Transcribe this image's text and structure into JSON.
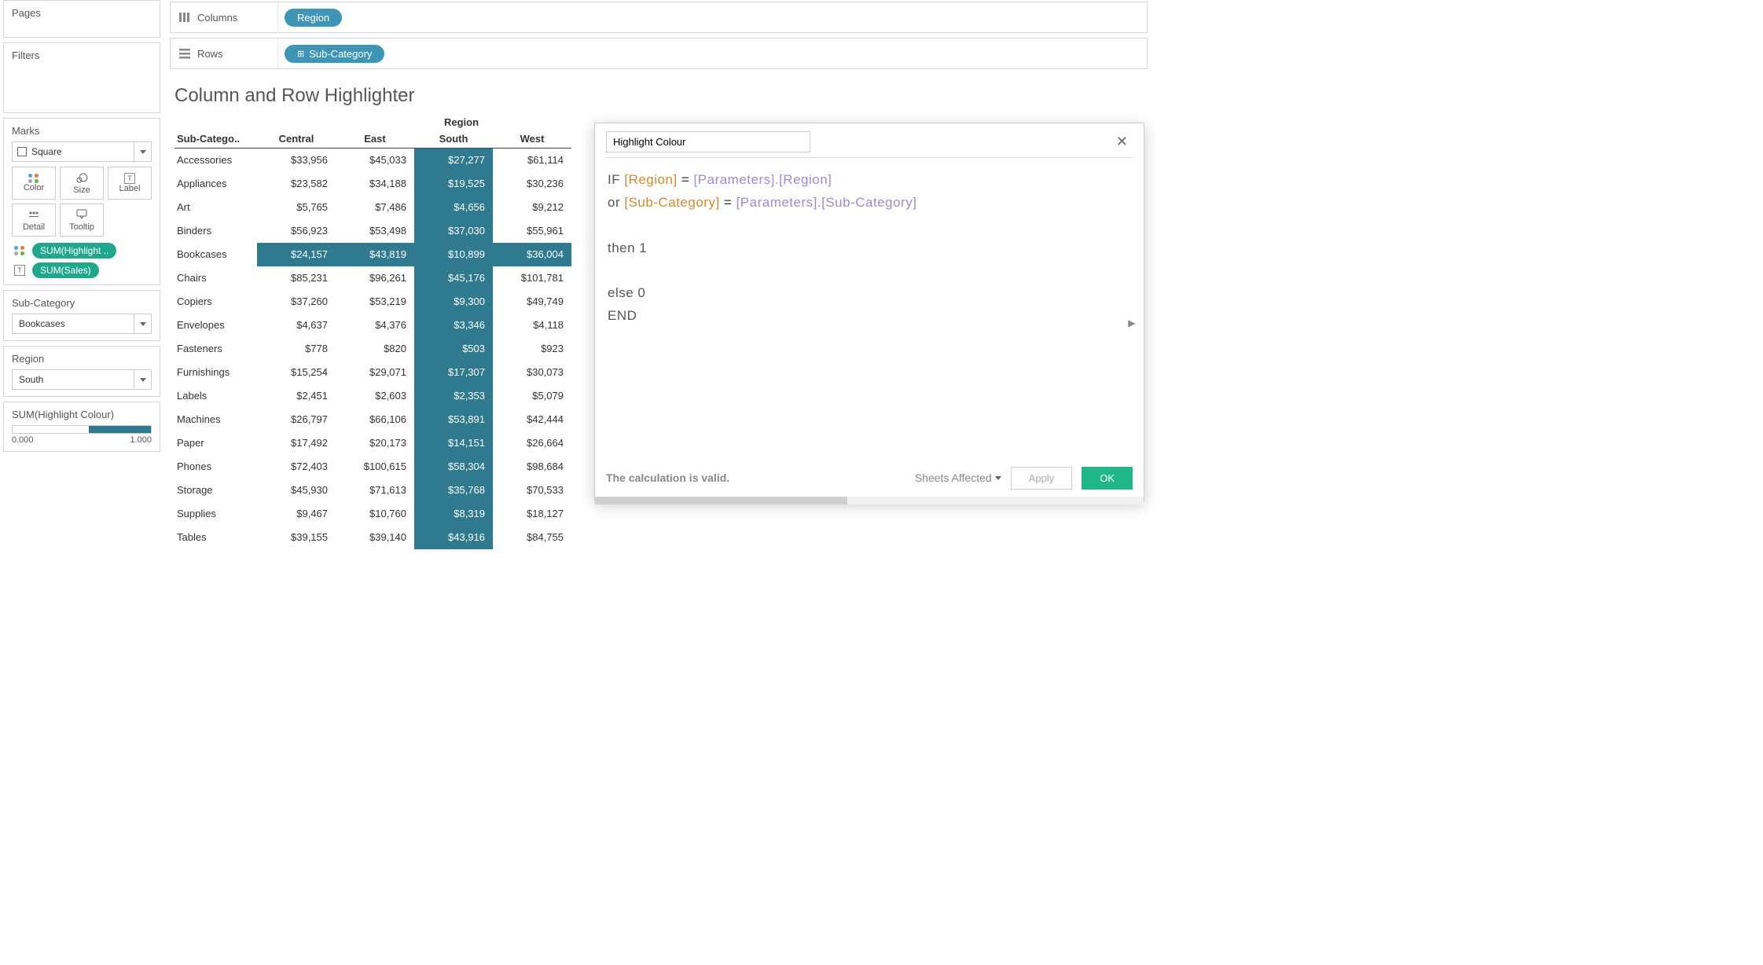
{
  "sidebar": {
    "pages_title": "Pages",
    "filters_title": "Filters",
    "marks_title": "Marks",
    "marks_type": "Square",
    "marks_buttons": {
      "color": "Color",
      "size": "Size",
      "label": "Label",
      "detail": "Detail",
      "tooltip": "Tooltip"
    },
    "marks_pills": {
      "color_pill": "SUM(Highlight ..",
      "label_pill": "SUM(Sales)"
    },
    "subcat_label": "Sub-Category",
    "subcat_value": "Bookcases",
    "region_label": "Region",
    "region_value": "South",
    "slider_label": "SUM(Highlight Colour)",
    "slider_min": "0.000",
    "slider_max": "1.000"
  },
  "shelves": {
    "columns_label": "Columns",
    "columns_pill": "Region",
    "rows_label": "Rows",
    "rows_pill": "Sub-Category"
  },
  "viz": {
    "title": "Column and Row Highlighter",
    "col_header": "Region",
    "row_header": "Sub-Catego..",
    "columns": [
      "Central",
      "East",
      "South",
      "West"
    ],
    "rows": [
      {
        "label": "Accessories",
        "vals": [
          "$33,956",
          "$45,033",
          "$27,277",
          "$61,114"
        ]
      },
      {
        "label": "Appliances",
        "vals": [
          "$23,582",
          "$34,188",
          "$19,525",
          "$30,236"
        ]
      },
      {
        "label": "Art",
        "vals": [
          "$5,765",
          "$7,486",
          "$4,656",
          "$9,212"
        ]
      },
      {
        "label": "Binders",
        "vals": [
          "$56,923",
          "$53,498",
          "$37,030",
          "$55,961"
        ]
      },
      {
        "label": "Bookcases",
        "vals": [
          "$24,157",
          "$43,819",
          "$10,899",
          "$36,004"
        ],
        "hl_row": true
      },
      {
        "label": "Chairs",
        "vals": [
          "$85,231",
          "$96,261",
          "$45,176",
          "$101,781"
        ]
      },
      {
        "label": "Copiers",
        "vals": [
          "$37,260",
          "$53,219",
          "$9,300",
          "$49,749"
        ]
      },
      {
        "label": "Envelopes",
        "vals": [
          "$4,637",
          "$4,376",
          "$3,346",
          "$4,118"
        ]
      },
      {
        "label": "Fasteners",
        "vals": [
          "$778",
          "$820",
          "$503",
          "$923"
        ]
      },
      {
        "label": "Furnishings",
        "vals": [
          "$15,254",
          "$29,071",
          "$17,307",
          "$30,073"
        ]
      },
      {
        "label": "Labels",
        "vals": [
          "$2,451",
          "$2,603",
          "$2,353",
          "$5,079"
        ]
      },
      {
        "label": "Machines",
        "vals": [
          "$26,797",
          "$66,106",
          "$53,891",
          "$42,444"
        ]
      },
      {
        "label": "Paper",
        "vals": [
          "$17,492",
          "$20,173",
          "$14,151",
          "$26,664"
        ]
      },
      {
        "label": "Phones",
        "vals": [
          "$72,403",
          "$100,615",
          "$58,304",
          "$98,684"
        ]
      },
      {
        "label": "Storage",
        "vals": [
          "$45,930",
          "$71,613",
          "$35,768",
          "$70,533"
        ]
      },
      {
        "label": "Supplies",
        "vals": [
          "$9,467",
          "$10,760",
          "$8,319",
          "$18,127"
        ]
      },
      {
        "label": "Tables",
        "vals": [
          "$39,155",
          "$39,140",
          "$43,916",
          "$84,755"
        ]
      }
    ],
    "hl_col_index": 2
  },
  "calc": {
    "name": "Highlight Colour",
    "tokens": {
      "if": "IF",
      "region_f": "[Region]",
      "eq": " = ",
      "params_region": "[Parameters].[Region]",
      "or": "or ",
      "subcat_f": "[Sub-Category]",
      "params_subcat": "[Parameters].[Sub-Category]",
      "then": "then 1",
      "else": "else 0",
      "end": "END"
    },
    "valid_msg": "The calculation is valid.",
    "sheets_affected": "Sheets Affected",
    "apply": "Apply",
    "ok": "OK"
  }
}
